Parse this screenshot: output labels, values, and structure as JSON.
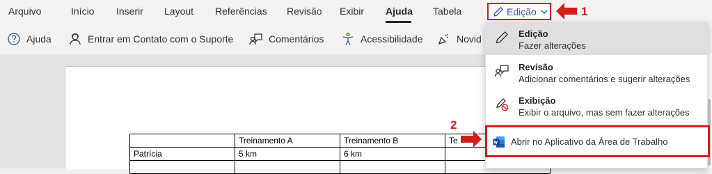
{
  "ribbon": {
    "tabs": [
      "Arquivo",
      "Início",
      "Inserir",
      "Layout",
      "Referências",
      "Revisão",
      "Exibir",
      "Ajuda",
      "Tabela"
    ],
    "active_tab": "Ajuda",
    "edit_mode_button": {
      "label": "Edição",
      "icon": "pencil-icon"
    }
  },
  "commands": [
    {
      "label": "Ajuda",
      "icon": "help-circle-icon"
    },
    {
      "label": "Entrar em Contato com o Suporte",
      "icon": "person-support-icon"
    },
    {
      "label": "Comentários",
      "icon": "feedback-icon"
    },
    {
      "label": "Acessibilidade",
      "icon": "accessibility-icon"
    },
    {
      "label": "Novid",
      "icon": "whats-new-icon"
    }
  ],
  "callouts": [
    "1",
    "2"
  ],
  "dropdown": {
    "items": [
      {
        "title": "Edição",
        "description": "Fazer alterações",
        "icon": "pencil-icon",
        "selected": true
      },
      {
        "title": "Revisão",
        "description": "Adicionar comentários e sugerir alterações",
        "icon": "review-icon",
        "selected": false
      },
      {
        "title": "Exibição",
        "description": "Exibir o arquivo, mas sem fazer alterações",
        "icon": "view-only-icon",
        "selected": false
      }
    ],
    "open_desktop": {
      "label": "Abrir no Aplicativo da Área de Trabalho",
      "icon": "word-icon"
    }
  },
  "document": {
    "table": {
      "headers": [
        "",
        "Treinamento A",
        "Treinamento B",
        "Te"
      ],
      "rows": [
        [
          "Patrícia",
          "5 km",
          "6 km",
          ""
        ]
      ]
    }
  },
  "colors": {
    "accent": "#2b579a",
    "callout": "#d21d1d",
    "selected_bg": "#e1dfdd"
  }
}
